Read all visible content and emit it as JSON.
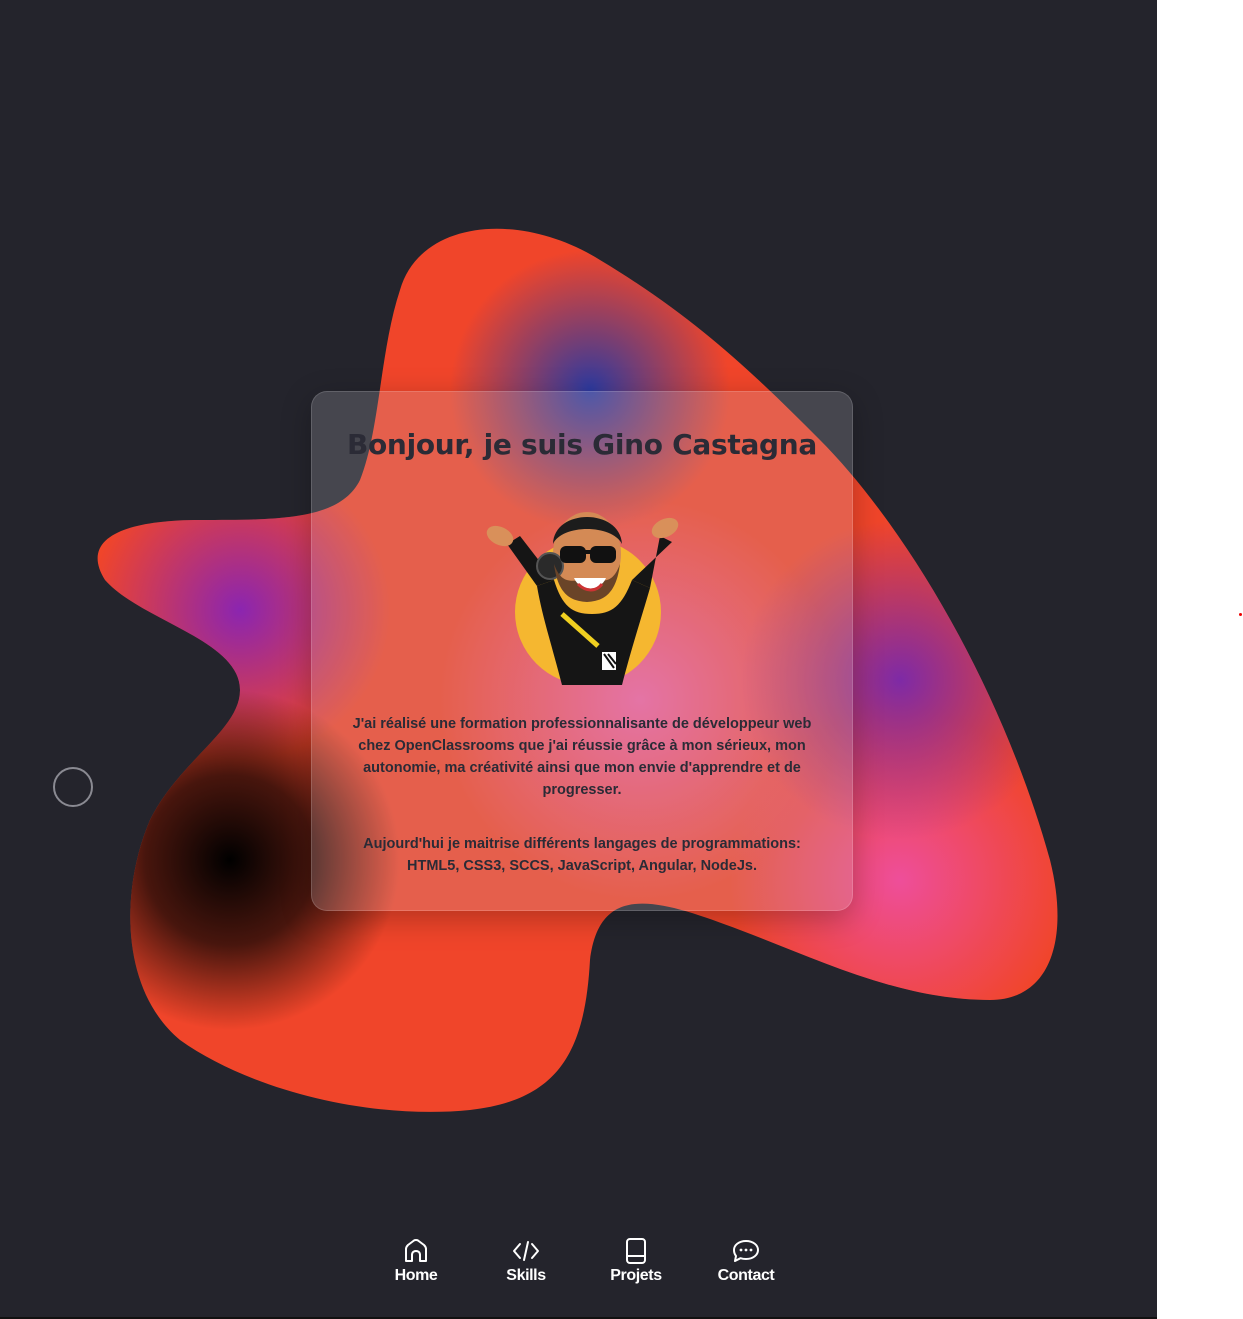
{
  "hero": {
    "title": "Bonjour, je suis Gino Castagna",
    "paragraph1": "J'ai réalisé une formation professionnalisante de développeur web chez OpenClassrooms que j'ai réussie grâce à mon sérieux, mon autonomie, ma créativité ainsi que mon envie d'apprendre et de progresser.",
    "paragraph2": "Aujourd'hui je maitrise différents langages de programmations: HTML5, CSS3, SCCS, JavaScript, Angular, NodeJs.",
    "avatar_icon": "memoji-avatar"
  },
  "nav": {
    "items": [
      {
        "label": "Home",
        "icon": "home-icon"
      },
      {
        "label": "Skills",
        "icon": "code-icon"
      },
      {
        "label": "Projets",
        "icon": "book-icon"
      },
      {
        "label": "Contact",
        "icon": "chat-icon"
      }
    ]
  },
  "colors": {
    "background": "#24242c",
    "blob_orange": "#f0452a",
    "blob_purple": "#8a2aa8",
    "blob_pink": "#ee5aa0",
    "blob_blue": "#3a4aa8",
    "text_dark": "#2b2b36",
    "nav_text": "#ffffff"
  }
}
